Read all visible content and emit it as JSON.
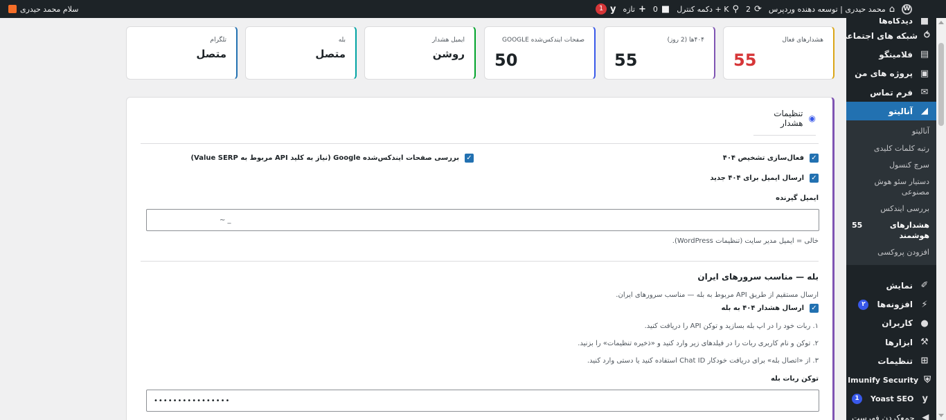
{
  "adminbar": {
    "greeting": "سلام محمد حیدری",
    "site_name": "محمد حیدری | توسعه دهنده وردپرس",
    "updates_count": "2",
    "shortcut_label": "دکمه کنترل + K",
    "comments_count": "0",
    "new_label": "تازه",
    "yoast_badge": "1"
  },
  "stats": [
    {
      "label": "هشدارهای فعال",
      "value": "55",
      "color": "#d63638",
      "accent": "#dba617"
    },
    {
      "label": "۴۰۴ها (2 روز)",
      "value": "55",
      "color": "#1d2327",
      "accent": "#7f54b3"
    },
    {
      "label": "صفحات ایندکس‌شده GOOGLE",
      "value": "50",
      "color": "#1d2327",
      "accent": "#3858e9"
    },
    {
      "label": "ایمیل هشدار",
      "value": "روشن",
      "color": "#1d2327",
      "accent": "#00a32a"
    },
    {
      "label": "بله",
      "value": "متصل",
      "color": "#1d2327",
      "accent": "#00a3a3"
    },
    {
      "label": "تلگرام",
      "value": "متصل",
      "color": "#1d2327",
      "accent": "#2271b1"
    }
  ],
  "panel": {
    "title": "تنظیمات هشدار",
    "cb_404": "فعال‌سازی تشخیص ۴۰۴",
    "cb_google": "بررسی صفحات ایندکس‌شده Google (نیاز به کلید API مربوط به Value SERP)",
    "cb_email_404": "ارسال ایمیل برای ۴۰۴ جدید",
    "recipient_label": "ایمیل گیرنده",
    "recipient_value": "~ _",
    "recipient_hint": "خالی = ایمیل مدیر سایت (تنظیمات WordPress).",
    "bale_title": "بله — مناسب سرورهای ایران",
    "bale_desc": "ارسال مستقیم از طریق API مربوط به بله — مناسب سرورهای ایران.",
    "cb_bale": "ارسال هشدار ۴۰۴ به بله",
    "step1": "۱. ربات خود را در اپ بله بسازید و توکن API را دریافت کنید.",
    "step2": "۲. توکن و نام کاربری ربات را در فیلدهای زیر وارد کنید و «ذخیره تنظیمات» را بزنید.",
    "step3": "۳. از «اتصال بله» برای دریافت خودکار Chat ID استفاده کنید یا دستی وارد کنید.",
    "token_label": "توکن ربات بله",
    "token_value": "••••••••••••••••"
  },
  "sidebar": {
    "top_items": [
      "دیدگاه‌ها",
      "شبکه های اجتماعی",
      "فلامینگو",
      "پروژه های من",
      "فرم تماس"
    ],
    "active": "آنالیتو",
    "submenu": [
      "آنالیتو",
      "رتبه کلمات کلیدی",
      "سرچ کنسول",
      "دستیار سئو هوش مصنوعی",
      "بررسی ایندکس"
    ],
    "current_sub": "هشدارهای هوشمند",
    "current_sub_badge": "55",
    "last_sub": "افزودن پروکسی",
    "bottom_items": [
      "نمایش",
      "افزونه‌ها",
      "کاربران",
      "ابزارها",
      "تنظیمات",
      "Imunify Security",
      "Yoast SEO",
      "جمع‌کردن فهرست"
    ],
    "plugins_badge": "۲",
    "yoast_badge": "1"
  }
}
